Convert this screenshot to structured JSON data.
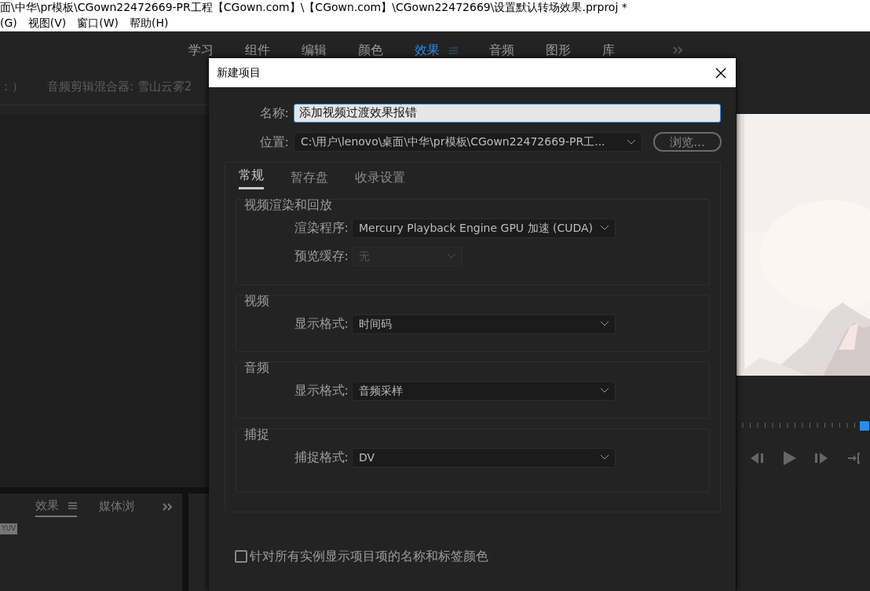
{
  "window": {
    "title": "面\\中华\\pr模板\\CGown22472669-PR工程【CGown.com】\\【CGown.com】\\CGown22472669\\设置默认转场效果.prproj *"
  },
  "menu": [
    "(G)",
    "视图(V)",
    "窗口(W)",
    "帮助(H)"
  ],
  "workspaces": [
    {
      "label": "学习",
      "selected": false
    },
    {
      "label": "组件",
      "selected": false
    },
    {
      "label": "编辑",
      "selected": false
    },
    {
      "label": "颜色",
      "selected": false
    },
    {
      "label": "效果",
      "selected": true
    },
    {
      "label": "音频",
      "selected": false
    },
    {
      "label": "图形",
      "selected": false
    },
    {
      "label": "库",
      "selected": false
    }
  ],
  "source_panel": {
    "tabs": [
      "：）",
      "音频剪辑混合器: 雪山云雾2"
    ]
  },
  "effects_panel": {
    "tabs": [
      {
        "label": "效果",
        "selected": true
      },
      {
        "label": "媒体浏",
        "selected": false
      }
    ],
    "badge": "YUV"
  },
  "program_monitor": {
    "playhead": {
      "level": 0.96
    }
  },
  "dialog": {
    "title": "新建项目",
    "name": {
      "label": "名称:",
      "value": "添加视频过渡效果报错"
    },
    "location": {
      "label": "位置:",
      "value": "C:\\用户\\lenovo\\桌面\\中华\\pr模板\\CGown22472669-PR工..."
    },
    "browse": "浏览...",
    "tabs": [
      {
        "label": "常规",
        "selected": true
      },
      {
        "label": "暂存盘",
        "selected": false
      },
      {
        "label": "收录设置",
        "selected": false
      }
    ],
    "groups": [
      {
        "title": "视频渲染和回放",
        "fields": [
          {
            "label": "渲染程序:",
            "value": "Mercury Playback Engine GPU 加速 (CUDA)",
            "disabled": false,
            "wide": true
          },
          {
            "label": "预览缓存:",
            "value": "无",
            "disabled": true,
            "wide": false
          }
        ]
      },
      {
        "title": "视频",
        "fields": [
          {
            "label": "显示格式:",
            "value": "时间码",
            "disabled": false,
            "wide": true
          }
        ]
      },
      {
        "title": "音频",
        "fields": [
          {
            "label": "显示格式:",
            "value": "音频采样",
            "disabled": false,
            "wide": true
          }
        ]
      },
      {
        "title": "捕捉",
        "fields": [
          {
            "label": "捕捉格式:",
            "value": "DV",
            "disabled": false,
            "wide": true
          }
        ]
      }
    ],
    "checkbox": {
      "label": "针对所有实例显示项目项的名称和标签颜色",
      "checked": false
    }
  }
}
